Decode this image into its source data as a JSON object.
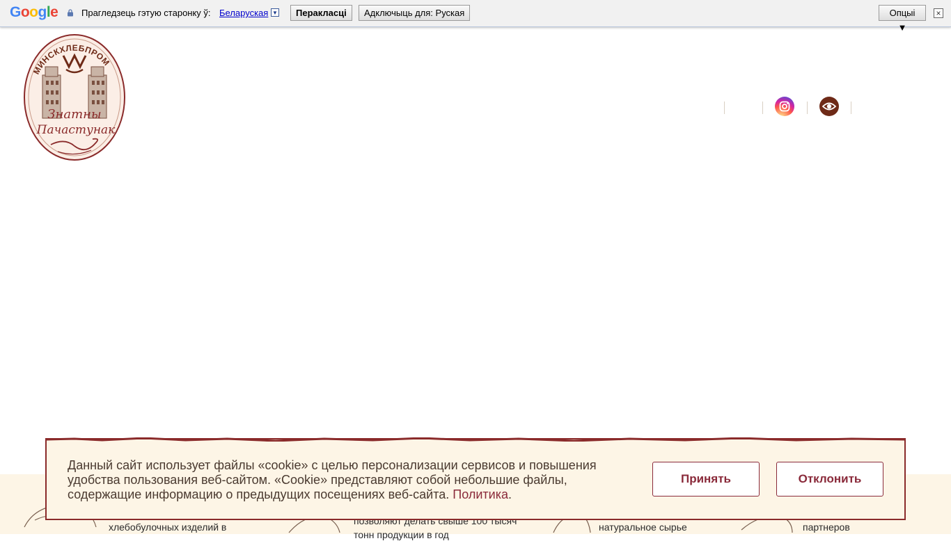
{
  "translate_bar": {
    "logo": "Google",
    "prompt": "Прагледзець гэтую старонку ў:",
    "language": "Беларуская",
    "translate_button": "Перакласці",
    "disable_button": "Адключыць для: Руская",
    "options_button": "Опцыі ▼",
    "close": "×",
    "logo_colors": [
      "#4285F4",
      "#EA4335",
      "#FBBC05",
      "#4285F4",
      "#34A853",
      "#EA4335"
    ]
  },
  "header": {
    "logo_top_text": "МИНСКХЛЕБПРОМ",
    "logo_script_line1": "Знатны",
    "logo_script_line2": "Пачастунак",
    "icons": [
      "instagram-icon",
      "eye-icon"
    ],
    "brand_color": "#6e2a17"
  },
  "features": {
    "item1": "хлебобулочных изделий в",
    "item2_line1": "позволяют делать свыше 100 тысяч",
    "item2_line2": "тонн продукции в год",
    "item3": "натуральное сырье",
    "item4": "партнеров"
  },
  "cookie": {
    "text": "Данный сайт использует файлы «cookie» с целью персонализации сервисов и повышения удобства пользования веб-сайтом. «Cookie» представляют собой небольшие файлы, содержащие информацию о предыдущих посещениях веб-сайта.",
    "link": "Политика",
    "period": ".",
    "accept": "Принять",
    "decline": "Отклонить",
    "accent_color": "#8a2a3a"
  }
}
